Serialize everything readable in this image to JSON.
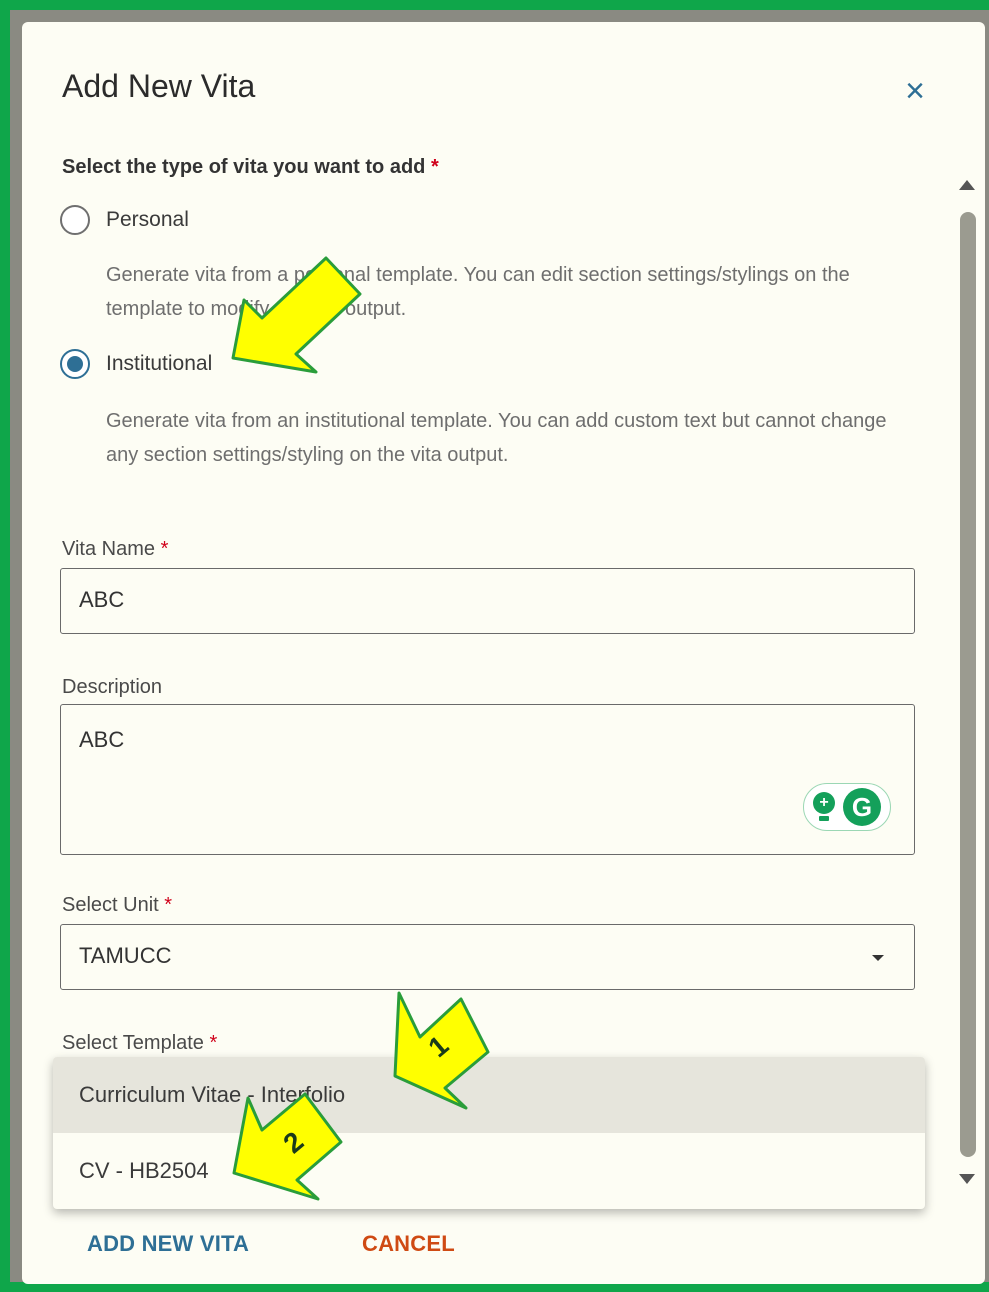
{
  "dialog": {
    "title": "Add New Vita",
    "close_icon": "close-icon"
  },
  "vita_type": {
    "label": "Select the type of vita you want to add",
    "required_mark": "*",
    "options": [
      {
        "label": "Personal",
        "selected": false,
        "description": "Generate vita from a personal template. You can edit section settings/stylings on the template to modify the vita output."
      },
      {
        "label": "Institutional",
        "selected": true,
        "description": "Generate vita from an institutional template. You can add custom text but cannot change any section settings/styling on the vita output."
      }
    ]
  },
  "vita_name": {
    "label": "Vita Name",
    "required_mark": "*",
    "value": "ABC"
  },
  "description": {
    "label": "Description",
    "value": "ABC"
  },
  "unit": {
    "label": "Select Unit",
    "required_mark": "*",
    "value": "TAMUCC"
  },
  "template": {
    "label": "Select Template",
    "required_mark": "*",
    "options": [
      "Curriculum Vitae - Interfolio",
      "CV - HB2504"
    ],
    "highlighted": "Curriculum Vitae - Interfolio"
  },
  "actions": {
    "add": "ADD NEW VITA",
    "cancel": "CANCEL"
  },
  "callouts": [
    "1",
    "2"
  ],
  "colors": {
    "accent": "#2e6f95",
    "cancel": "#cf4a13",
    "frame": "#0fa64a",
    "callout_fill": "#ffff00",
    "callout_stroke": "#2a9d3a"
  }
}
